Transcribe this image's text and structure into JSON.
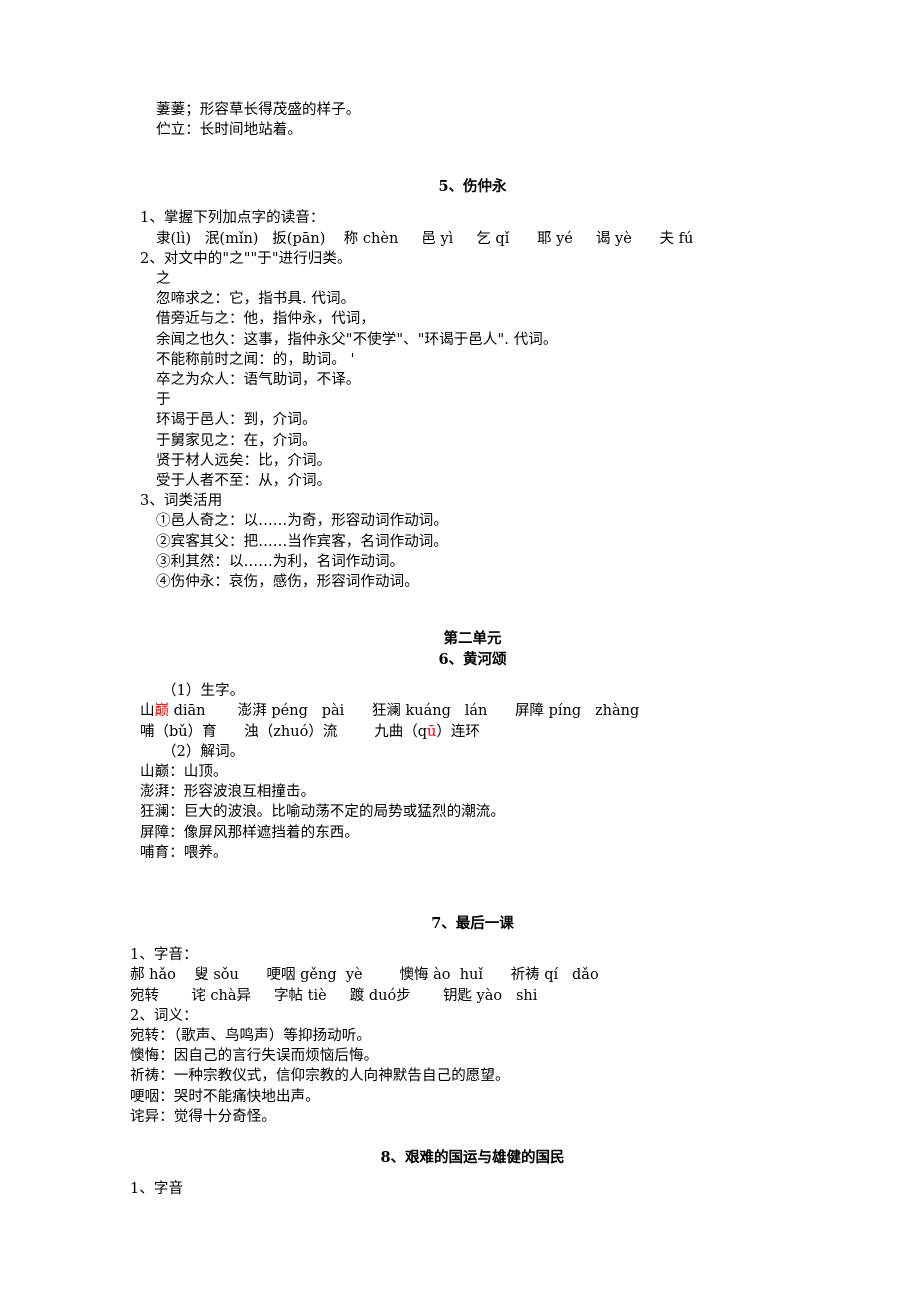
{
  "document": {
    "top_notes": [
      "萋萋；形容草长得茂盛的样子。",
      "伫立：长时间地站着。"
    ],
    "lesson5": {
      "heading": "5、伤仲永",
      "item1_label": "1、掌握下列加点字的读音：",
      "pinyin_row": "隶(lì)   泯(mǐn)   扳(pān)    称 chèn     邑 yì     乞 qǐ      耶 yé     谒 yè      夫 fú",
      "item2_label": "2、对文中的\"之\"\"于\"进行归类。",
      "zhi_label": "之",
      "zhi_entries": [
        "忽啼求之：它，指书具. 代词。",
        "借旁近与之：他，指仲永，代词，",
        "余闻之也久：这事，指仲永父\"不使学\"、\"环谒于邑人\". 代词。",
        "不能称前时之闻：的，助词。 '",
        "卒之为众人：语气助词，不译。"
      ],
      "yu_label": "于",
      "yu_entries": [
        "环谒于邑人：到，介词。",
        "于舅家见之：在，介词。",
        "贤于材人远矣：比，介词。",
        "受于人者不至：从，介词。"
      ],
      "item3_label": "3、词类活用",
      "item3_entries": [
        "①邑人奇之：以……为奇，形容动词作动词。",
        "②宾客其父：把……当作宾客，名词作动词。",
        "③利其然：以……为利，名词作动词。",
        "④伤仲永：哀伤，感伤，形容词作动词。"
      ]
    },
    "unit2": {
      "unit_heading": "第二单元",
      "lesson6_heading": "6、黄河颂"
    },
    "lesson6": {
      "item1_label": "（1）生字。",
      "pinyin_row1": {
        "pre": "山",
        "red1": "巅",
        "mid": " diān       澎湃 péng   pài      狂澜 kuáng   lán      屏障 píng   zhàng"
      },
      "pinyin_row2": {
        "pre": "哺（bǔ）育      浊（zhuó）流        九曲（q",
        "red1": "ū",
        "post": "）连环"
      },
      "item2_label": "（2）解词。",
      "definitions": [
        "山巅：山顶。",
        "澎湃：形容波浪互相撞击。",
        "狂澜：巨大的波浪。比喻动荡不定的局势或猛烈的潮流。",
        "屏障：像屏风那样遮挡着的东西。",
        "哺育：喂养。"
      ]
    },
    "lesson7": {
      "heading": "7、最后一课",
      "item1_label": "1、字音：",
      "pinyin_row1": "郝 hǎo    叟 sǒu      哽咽 gěng  yè        懊悔 ào  huǐ      祈祷 qí   dǎo",
      "pinyin_row2": "宛转       诧 chà异     字帖 tiè     踱 duó步       钥匙 yào   shi",
      "item2_label": "2、词义：",
      "definitions": [
        "宛转：（歌声、鸟鸣声）等抑扬动听。",
        "懊悔：因自己的言行失误而烦恼后悔。",
        "祈祷：一种宗教仪式，信仰宗教的人向神默告自己的愿望。",
        "哽咽：哭时不能痛快地出声。",
        "诧异：觉得十分奇怪。"
      ]
    },
    "lesson8": {
      "heading": "8、艰难的国运与雄健的国民",
      "item1_label": "1、字音"
    }
  }
}
